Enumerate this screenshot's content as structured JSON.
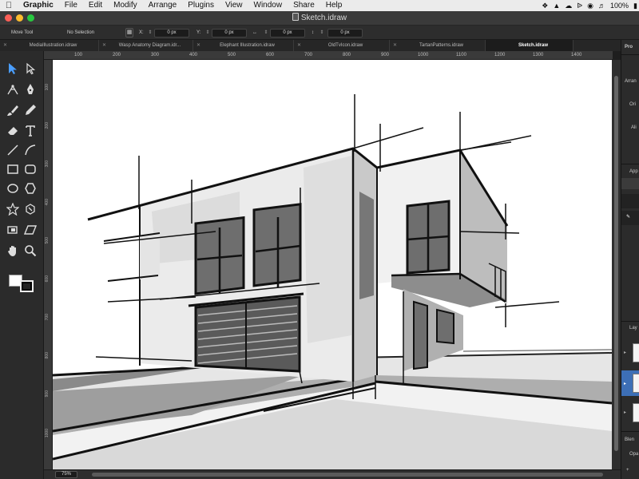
{
  "menubar": {
    "apple_icon": "apple-logo",
    "app_name": "Graphic",
    "items": [
      "File",
      "Edit",
      "Modify",
      "Arrange",
      "Plugins",
      "View",
      "Window",
      "Share",
      "Help"
    ],
    "battery": "100%",
    "status_icons": [
      "dropbox-icon",
      "evernote-icon",
      "cloud-icon",
      "bluetooth-icon",
      "wifi-icon",
      "volume-icon"
    ]
  },
  "window": {
    "title": "Sketch.idraw"
  },
  "options": {
    "tool_name": "Move Tool",
    "selection": "No Selection",
    "x_label": "X:",
    "x_value": "0 px",
    "y_label": "Y:",
    "y_value": "0 px",
    "w_value": "0 px",
    "h_value": "0 px"
  },
  "tabs": [
    {
      "label": "MediaIllustration.idraw",
      "active": false
    },
    {
      "label": "Wasp Anatomy Diagram.idr...",
      "active": false
    },
    {
      "label": "Elephant Illustration.idraw",
      "active": false
    },
    {
      "label": "OldTvIcon.idraw",
      "active": false
    },
    {
      "label": "TartanPatterns.idraw",
      "active": false
    },
    {
      "label": "Sketch.idraw",
      "active": true
    }
  ],
  "ruler": {
    "top_labels": [
      "100",
      "200",
      "300",
      "400",
      "500",
      "600",
      "700",
      "800",
      "900",
      "1000",
      "1100",
      "1200",
      "1300",
      "1400"
    ],
    "left_labels": [
      "100",
      "200",
      "300",
      "400",
      "500",
      "600",
      "700",
      "800",
      "900",
      "1000",
      "1100",
      "1200"
    ]
  },
  "status": {
    "zoom": "75%"
  },
  "inspector": {
    "labels": [
      "Pro",
      "Arran",
      "Ori",
      "Ali",
      "App",
      "Lay",
      "Blen",
      "Opa"
    ]
  },
  "colors": {
    "accent": "#3d6fb6",
    "selected_tool": "#4a9eff"
  }
}
